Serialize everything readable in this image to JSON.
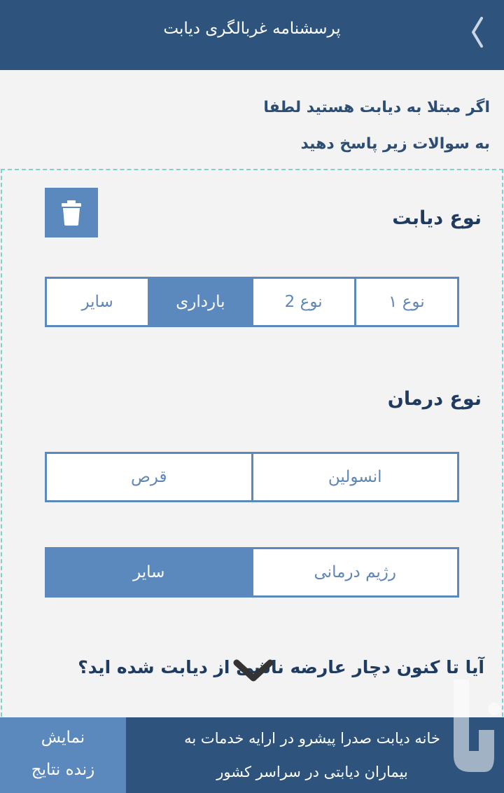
{
  "header": {
    "title": "پرسشنامه غربالگری دیابت",
    "back_icon": "chevron-left-icon"
  },
  "intro": {
    "line1": "اگر مبتلا به دیابت هستید لطفا",
    "line2": "به سوالات زیر پاسخ دهید"
  },
  "card": {
    "delete_icon": "trash-icon",
    "diabetes_type": {
      "title": "نوع دیابت",
      "options": [
        "نوع ۱",
        "نوع 2",
        "بارداری",
        "سایر"
      ],
      "selected": "بارداری"
    },
    "treatment_type": {
      "title": "نوع درمان",
      "row1": [
        "انسولین",
        "قرص"
      ],
      "row2": [
        "رژیم درمانی",
        "سایر"
      ],
      "selected": "سایر"
    },
    "question": "آیا تا کنون دچار عارضه ناشی از دیابت شده اید؟",
    "expand_icon": "chevron-down-icon"
  },
  "bottom": {
    "live_line1": "نمایش",
    "live_line2": "زنده نتایج",
    "promo_line1": "خانه دیابت صدرا پیشرو در ارایه خدمات به",
    "promo_line2": "بیماران دیابتی در سراسر کشور"
  },
  "colors": {
    "header": "#2e547e",
    "accent": "#5b88bd",
    "background": "#f3f3f3",
    "dashed_border": "#7fd0d0"
  }
}
